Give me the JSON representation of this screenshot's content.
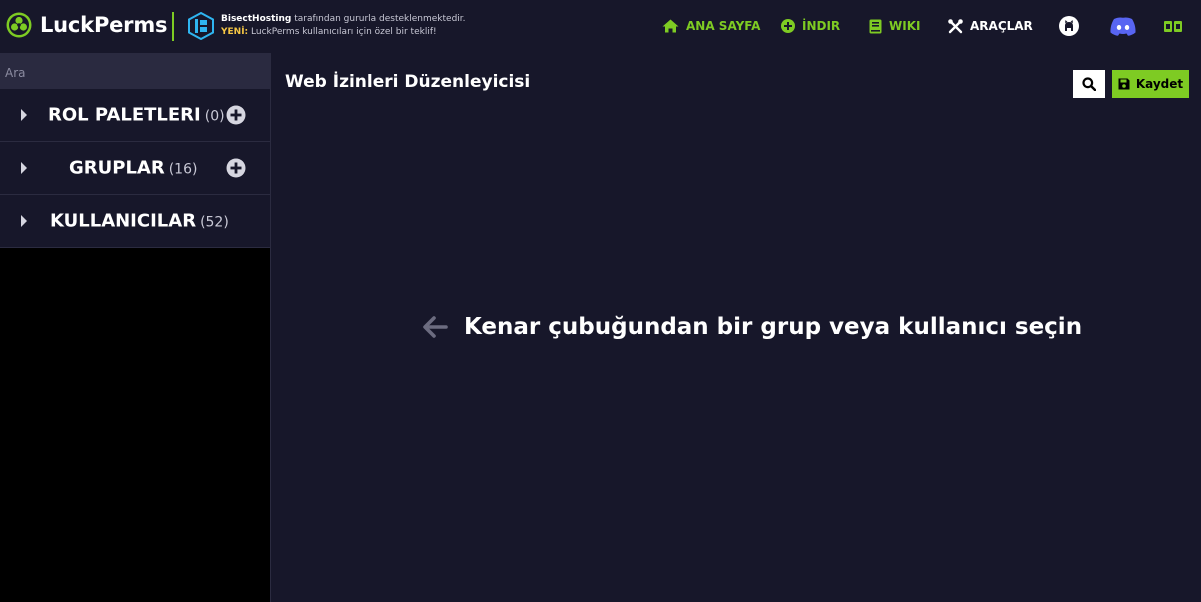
{
  "header": {
    "brand": "LuckPerms",
    "sponsor_name": "BisectHosting",
    "sponsor_line1_rest": " tarafından gururla desteklenmektedir.",
    "sponsor_new_tag": "YENİ:",
    "sponsor_line2_rest": " LuckPerms kullanıcıları için özel bir teklif!",
    "nav": {
      "home": "ANA SAYFA",
      "download": "İNDIR",
      "wiki": "WIKI",
      "tools": "ARAÇLAR"
    }
  },
  "sidebar": {
    "search_placeholder": "Ara",
    "items": [
      {
        "label": "ROL PALETLERI",
        "count": "(0)"
      },
      {
        "label": "GRUPLAR",
        "count": "(16)"
      },
      {
        "label": "KULLANICILAR",
        "count": "(52)"
      }
    ]
  },
  "main": {
    "title": "Web İzinleri Düzenleyicisi",
    "save_label": "Kaydet",
    "empty_message": "Kenar çubuğundan bir grup veya kullanıcı seçin"
  },
  "colors": {
    "accent": "#7ecb23",
    "background": "#17172a",
    "sidebar_background": "#000000",
    "discord": "#5865f2"
  }
}
